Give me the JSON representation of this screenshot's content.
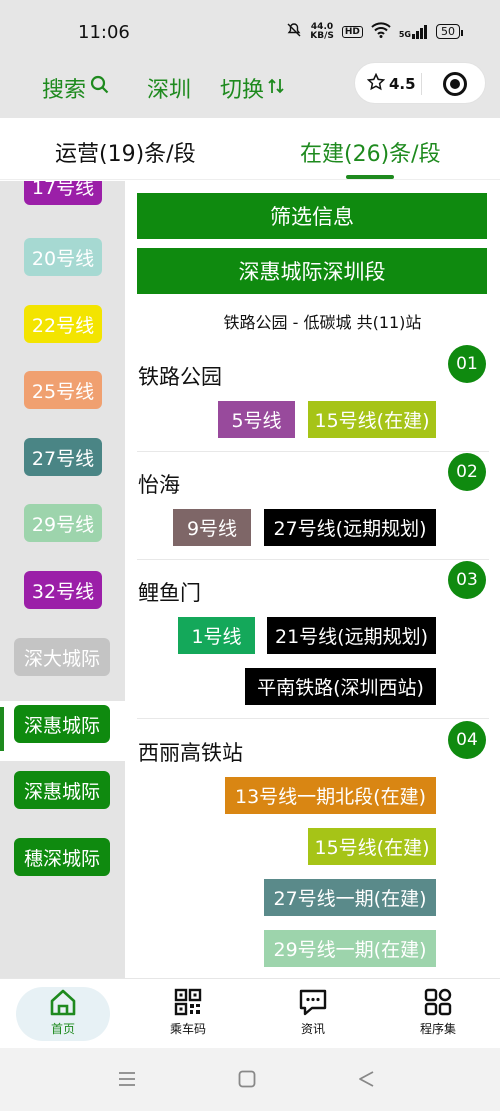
{
  "status": {
    "time": "11:06",
    "net_speed": "44.0",
    "net_unit": "KB/S",
    "hd": "HD",
    "battery": "50",
    "signal": "5G"
  },
  "header": {
    "search_label": "搜索",
    "city_label": "深圳",
    "switch_label": "切换",
    "rating": "4.5"
  },
  "tabs": {
    "operating": "运营(19)条/段",
    "building": "在建(26)条/段"
  },
  "sidebar": {
    "items": [
      {
        "label": "17号线",
        "color": "#9b1fa8"
      },
      {
        "label": "20号线",
        "color": "#a6d9d2"
      },
      {
        "label": "22号线",
        "color": "#f3e400"
      },
      {
        "label": "25号线",
        "color": "#f0a070"
      },
      {
        "label": "27号线",
        "color": "#4a8585"
      },
      {
        "label": "29号线",
        "color": "#9dd4ac"
      },
      {
        "label": "32号线",
        "color": "#9b1fa8"
      },
      {
        "label": "深大城际",
        "color": "#c4c4c4"
      },
      {
        "label": "深惠城际",
        "color": "#0f8a0f"
      },
      {
        "label": "深惠城际",
        "color": "#0f8a0f"
      },
      {
        "label": "穗深城际",
        "color": "#0f8a0f"
      }
    ]
  },
  "content": {
    "filter_label": "筛选信息",
    "line_title": "深惠城际深圳段",
    "range_text": "铁路公园 - 低碳城 共(11)站",
    "stations": [
      {
        "name": "铁路公园",
        "num": "01",
        "lines": [
          {
            "label": "5号线",
            "color": "#984a9c"
          },
          {
            "label": "15号线(在建)",
            "color": "#a6c417"
          }
        ]
      },
      {
        "name": "怡海",
        "num": "02",
        "lines": [
          {
            "label": "9号线",
            "color": "#7e6667"
          },
          {
            "label": "27号线(远期规划)",
            "color": "#000000"
          }
        ]
      },
      {
        "name": "鲤鱼门",
        "num": "03",
        "lines": [
          {
            "label": "1号线",
            "color": "#14a85a"
          },
          {
            "label": "21号线(远期规划)",
            "color": "#000000"
          },
          {
            "label": "平南铁路(深圳西站)",
            "color": "#000000"
          }
        ]
      },
      {
        "name": "西丽高铁站",
        "num": "04",
        "lines": [
          {
            "label": "13号线一期北段(在建)",
            "color": "#d98613"
          },
          {
            "label": "15号线(在建)",
            "color": "#a6c417"
          },
          {
            "label": "27号线一期(在建)",
            "color": "#5a8a8a"
          },
          {
            "label": "29号线一期(在建)",
            "color": "#9dd4ac"
          }
        ]
      }
    ]
  },
  "bottom_nav": {
    "home": "首页",
    "qrcode": "乘车码",
    "news": "资讯",
    "apps": "程序集"
  },
  "colors": {
    "brand_green": "#1e8a1e",
    "banner_green": "#0f8a0f"
  }
}
